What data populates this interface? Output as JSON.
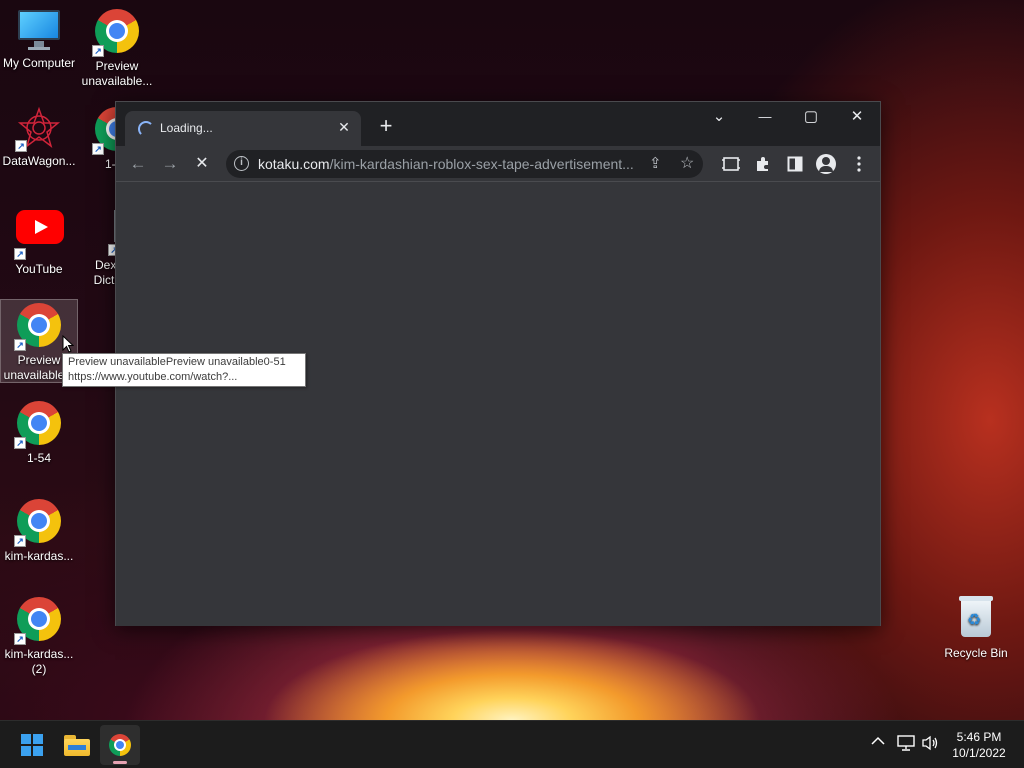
{
  "desktop": {
    "icons": [
      {
        "label": "My Computer"
      },
      {
        "label": "Preview unavailable..."
      },
      {
        "label": "DataWagon..."
      },
      {
        "label": "1-54"
      },
      {
        "label": "YouTube"
      },
      {
        "label": "Dex O... Diction..."
      },
      {
        "label": "Preview unavailable..."
      },
      {
        "label": "1-54"
      },
      {
        "label": "kim-kardas..."
      },
      {
        "label": "kim-kardas... (2)"
      }
    ],
    "recycle_bin": "Recycle Bin"
  },
  "tooltip": {
    "line1": "Preview unavailablePreview unavailable0-51",
    "line2": "https://www.youtube.com/watch?..."
  },
  "browser": {
    "tab_title": "Loading...",
    "tab_close": "✕",
    "new_tab": "+",
    "window_controls": {
      "tab_search": "⌄",
      "minimize": "—",
      "maximize": "▢",
      "close": "✕"
    },
    "url_domain": "kotaku.com",
    "url_path": "/kim-kardashian-roblox-sex-tape-advertisement...",
    "nav": {
      "back": "←",
      "forward": "→",
      "stop": "✕"
    },
    "toolbar_icons": [
      "info-icon",
      "share-icon",
      "bookmark-star-icon",
      "media-icon",
      "extensions-icon",
      "side-panel-icon",
      "profile-icon",
      "menu-icon"
    ]
  },
  "taskbar": {
    "time": "5:46 PM",
    "date": "10/1/2022",
    "tray": {
      "chevron": "^",
      "network": "🖧",
      "volume": "🔈"
    }
  }
}
